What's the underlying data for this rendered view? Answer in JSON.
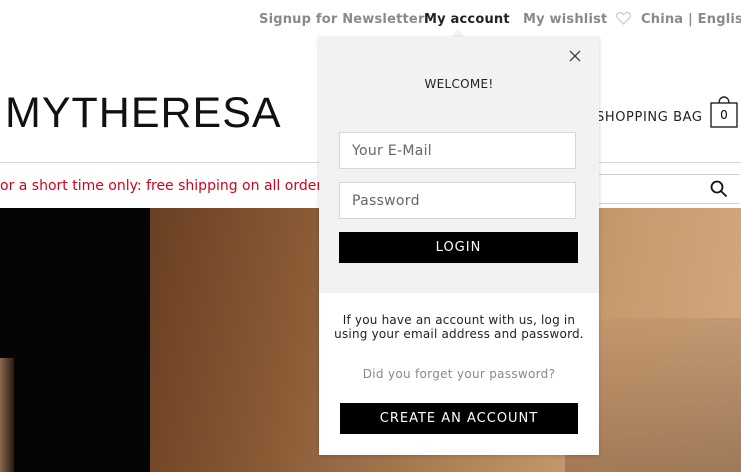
{
  "topbar": {
    "newsletter": "Signup for Newsletter",
    "account": "My account",
    "wishlist": "My wishlist",
    "locale": "China | English"
  },
  "brand": {
    "logo_text": "MYTHERESA"
  },
  "header": {
    "shopping_bag_label": "SHOPPING BAG",
    "bag_count": "0"
  },
  "promo": {
    "text": "or a short time only: free shipping on all orders"
  },
  "login_popup": {
    "welcome": "WELCOME!",
    "email_placeholder": "Your E-Mail",
    "password_placeholder": "Password",
    "login_label": "LOGIN",
    "info_text": "If you have an account with us, log in using your email address and password.",
    "forgot_link": "Did you forget your password?",
    "create_account_label": "CREATE AN ACCOUNT"
  },
  "colors": {
    "promo_red": "#d0021b",
    "popup_bg": "#f2f2f2",
    "button_bg": "#000000",
    "muted_text": "#8a8a8a"
  }
}
